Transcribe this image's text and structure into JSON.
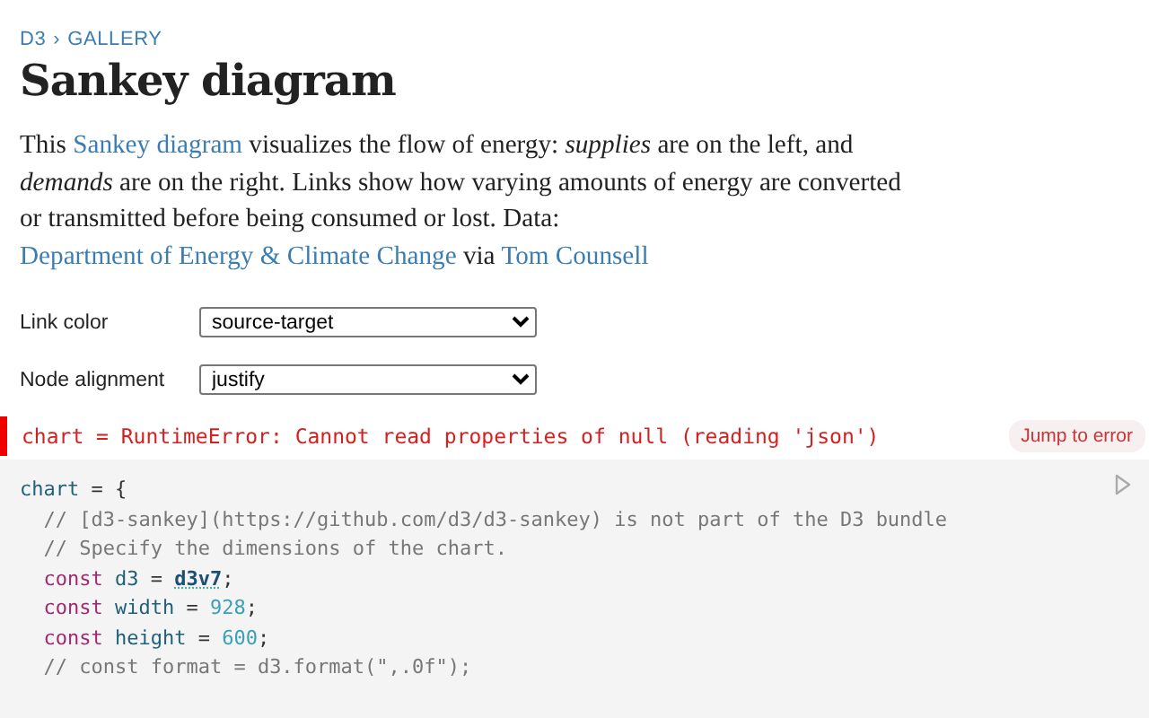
{
  "breadcrumb": [
    {
      "label": "D3"
    },
    {
      "label": "GALLERY"
    }
  ],
  "breadcrumb_separator": "›",
  "title": "Sankey diagram",
  "description": [
    {
      "kind": "text",
      "text": "This "
    },
    {
      "kind": "link",
      "text": "Sankey diagram"
    },
    {
      "kind": "text",
      "text": " visualizes the flow of energy: *supplies* are on the left, and *demands* are on the right. Links show how varying amounts of energy are converted or transmitted before being consumed or lost. Data: "
    },
    {
      "kind": "link",
      "text": "Department of Energy & Climate Change"
    },
    {
      "kind": "text",
      "text": " via "
    },
    {
      "kind": "link",
      "text": "Tom Counsell"
    }
  ],
  "controls": [
    {
      "label": "Link color",
      "value": "source-target"
    },
    {
      "label": "Node alignment",
      "value": "justify"
    }
  ],
  "error": {
    "message": "chart = RuntimeError: Cannot read properties of null (reading 'json')",
    "button": "Jump to error"
  },
  "code": {
    "lines": [
      {
        "tokens": [
          {
            "kind": "variable",
            "text": "chart"
          },
          {
            "kind": "plain",
            "text": " = {"
          }
        ],
        "children": [
          {
            "tokens": [
              {
                "kind": "comment",
                "text": "// [d3-sankey](https://github.com/d3/d3-sankey) is not part of the D3 bundle"
              }
            ]
          },
          {
            "tokens": [
              {
                "kind": "comment",
                "text": "// Specify the dimensions of the chart."
              }
            ]
          },
          {
            "tokens": [
              {
                "kind": "keyword",
                "text": "const"
              },
              {
                "kind": "variable",
                "text": " d3"
              },
              {
                "kind": "plain",
                "text": " = "
              },
              {
                "kind": "reference",
                "text": "d3v7"
              },
              {
                "kind": "plain",
                "text": ";"
              }
            ]
          },
          {
            "tokens": [
              {
                "kind": "keyword",
                "text": "const"
              },
              {
                "kind": "variable",
                "text": " width"
              },
              {
                "kind": "plain",
                "text": " = "
              },
              {
                "kind": "number",
                "text": "928"
              },
              {
                "kind": "plain",
                "text": ";"
              }
            ]
          },
          {
            "tokens": [
              {
                "kind": "keyword",
                "text": "const"
              },
              {
                "kind": "variable",
                "text": " height"
              },
              {
                "kind": "plain",
                "text": " = "
              },
              {
                "kind": "number",
                "text": "600"
              },
              {
                "kind": "plain",
                "text": ";"
              }
            ]
          },
          {
            "tokens": [
              {
                "kind": "comment",
                "text": "// const format = d3.format(\",.0f\");"
              }
            ]
          }
        ]
      }
    ]
  }
}
